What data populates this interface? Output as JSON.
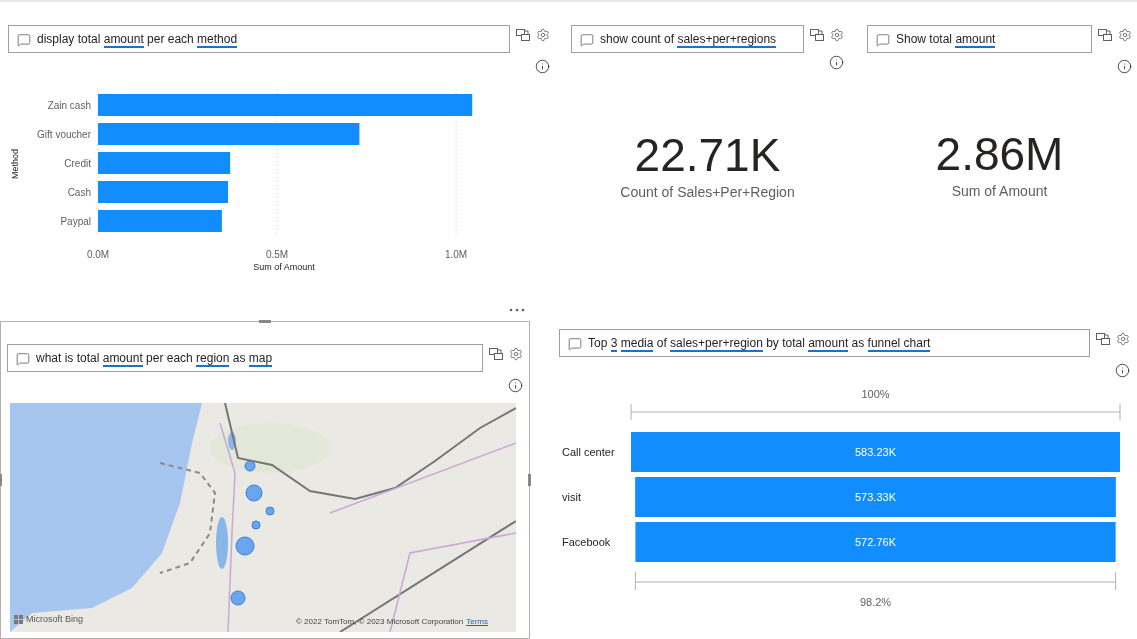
{
  "tiles": [
    {
      "kind": "bar_chart",
      "selected": false,
      "query": [
        {
          "text": "display total ",
          "recognized": false
        },
        {
          "text": "amount",
          "recognized": true
        },
        {
          "text": " per each ",
          "recognized": false
        },
        {
          "text": "method",
          "recognized": true
        }
      ],
      "chart_data": {
        "type": "bar",
        "orientation": "horizontal",
        "xlabel": "Sum of Amount",
        "ylabel": "Method",
        "categories": [
          "Zain cash",
          "Gift voucher",
          "Credit",
          "Cash",
          "Paypal"
        ],
        "values": [
          1045000,
          730000,
          369000,
          363000,
          346000
        ],
        "xlim": [
          0,
          1050000
        ],
        "xticks": [
          {
            "value": 0,
            "label": "0.0M"
          },
          {
            "value": 500000,
            "label": "0.5M"
          },
          {
            "value": 1000000,
            "label": "1.0M"
          }
        ]
      }
    },
    {
      "kind": "card",
      "selected": false,
      "query": [
        {
          "text": "show count of ",
          "recognized": false
        },
        {
          "text": "sales+per+regions",
          "recognized": true
        }
      ],
      "value": "22.71K",
      "caption": "Count of Sales+Per+Region"
    },
    {
      "kind": "card",
      "selected": false,
      "query": [
        {
          "text": "Show total ",
          "recognized": false
        },
        {
          "text": "amount",
          "recognized": true
        }
      ],
      "value": "2.86M",
      "caption": "Sum of Amount"
    },
    {
      "kind": "map",
      "selected": true,
      "query": [
        {
          "text": "what is total ",
          "recognized": false
        },
        {
          "text": "amount",
          "recognized": true
        },
        {
          "text": " per each ",
          "recognized": false
        },
        {
          "text": "region",
          "recognized": true
        },
        {
          "text": " as ",
          "recognized": false
        },
        {
          "text": "map",
          "recognized": true
        }
      ],
      "map": {
        "kind": "picture",
        "logo": "Microsoft Bing",
        "attribution": "© 2022 TomTom, © 2023 Microsoft Corporation",
        "terms_link": "Terms"
      }
    },
    {
      "kind": "funnel",
      "selected": false,
      "query": [
        {
          "text": "Top ",
          "recognized": false
        },
        {
          "text": "3",
          "recognized": true
        },
        {
          "text": "media",
          "recognized": true
        },
        {
          "text": " of ",
          "recognized": false
        },
        {
          "text": "sales+per+region",
          "recognized": true
        },
        {
          "text": " by total ",
          "recognized": false
        },
        {
          "text": "amount",
          "recognized": true
        },
        {
          "text": " as ",
          "recognized": false
        },
        {
          "text": "funnel chart",
          "recognized": true
        }
      ],
      "top_label": "100%",
      "bottom_label": "98.2%",
      "stages": [
        {
          "label": "Call center",
          "value": "583.23K"
        },
        {
          "label": "visit",
          "value": "573.33K"
        },
        {
          "label": "Facebook",
          "value": "572.76K"
        }
      ]
    }
  ]
}
